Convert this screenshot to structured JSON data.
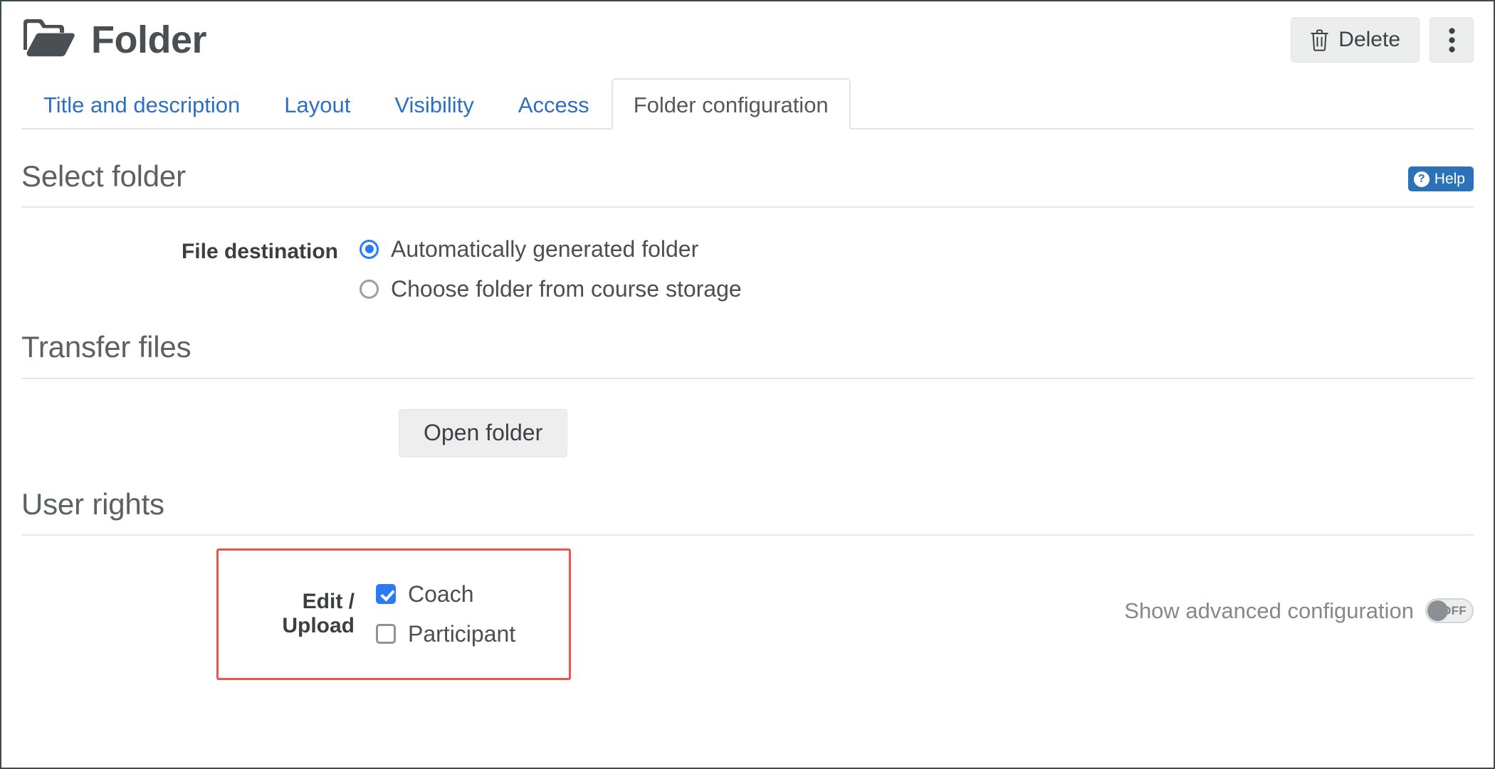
{
  "header": {
    "icon": "folder-open-icon",
    "title": "Folder",
    "delete_label": "Delete",
    "delete_icon": "trash-icon",
    "more_icon": "kebab-menu-icon"
  },
  "tabs": [
    {
      "label": "Title and description",
      "active": false
    },
    {
      "label": "Layout",
      "active": false
    },
    {
      "label": "Visibility",
      "active": false
    },
    {
      "label": "Access",
      "active": false
    },
    {
      "label": "Folder configuration",
      "active": true
    }
  ],
  "select_folder": {
    "heading": "Select folder",
    "help_label": "Help",
    "help_icon": "question-circle-icon",
    "help_mark": "?",
    "field_label": "File destination",
    "options": [
      {
        "label": "Automatically generated folder",
        "checked": true
      },
      {
        "label": "Choose folder from course storage",
        "checked": false
      }
    ]
  },
  "transfer_files": {
    "heading": "Transfer files",
    "open_folder_label": "Open folder"
  },
  "user_rights": {
    "heading": "User rights",
    "field_label": "Edit / Upload",
    "options": [
      {
        "label": "Coach",
        "checked": true
      },
      {
        "label": "Participant",
        "checked": false
      }
    ],
    "advanced_label": "Show advanced configuration",
    "advanced_state": "OFF"
  },
  "colors": {
    "accent_blue": "#2b7cf2",
    "link_blue": "#2e6fc5",
    "help_blue": "#2b72b9",
    "highlight_red": "#f0544c",
    "text_dark": "#3a3f43",
    "rule_grey": "#e7e7e7"
  }
}
